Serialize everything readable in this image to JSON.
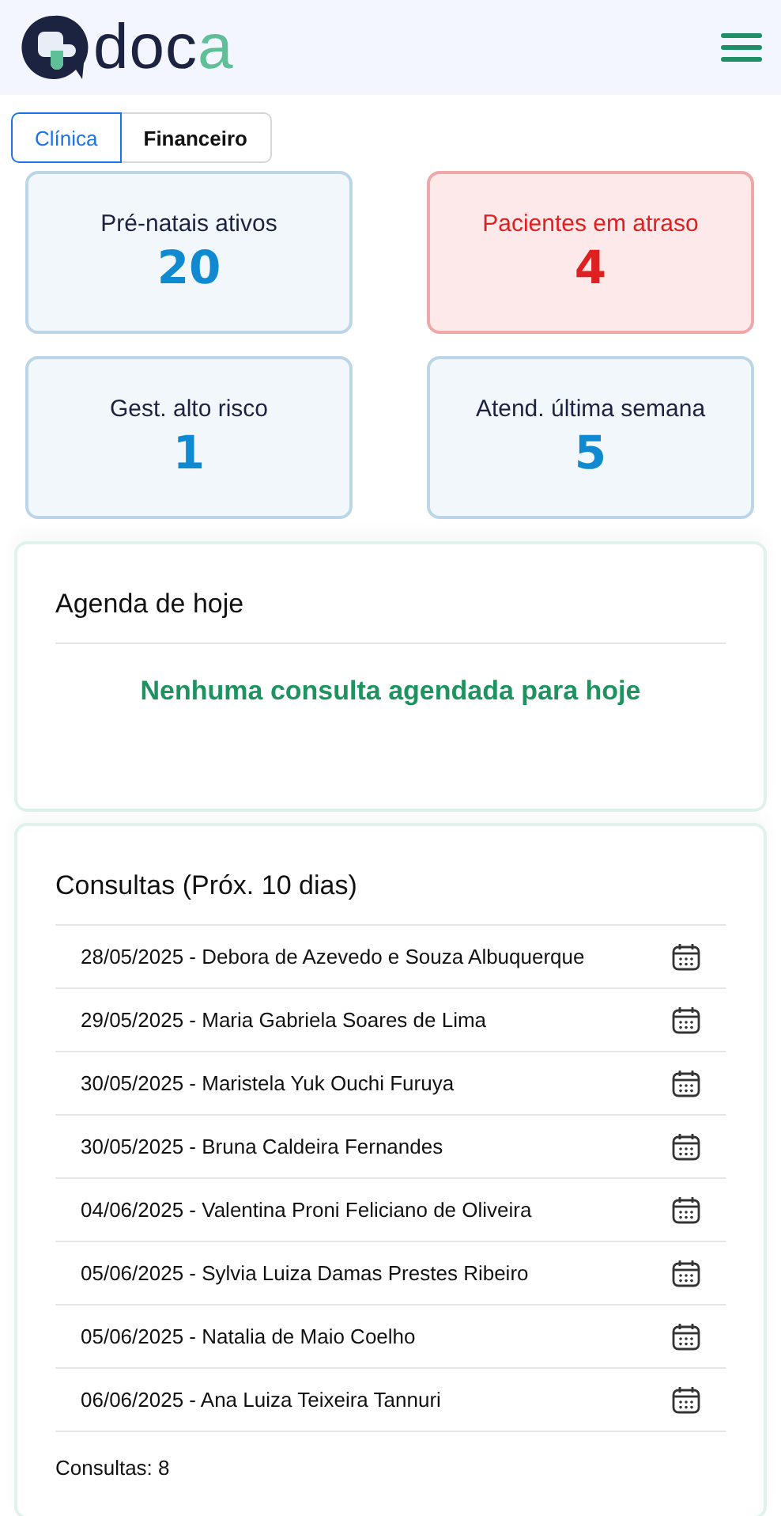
{
  "logo": {
    "text": "doc",
    "accent": "a"
  },
  "tabs": [
    {
      "label": "Clínica",
      "selected": true
    },
    {
      "label": "Financeiro",
      "selected": false
    }
  ],
  "stats": [
    {
      "label": "Pré-natais ativos",
      "value": "20",
      "alert": false
    },
    {
      "label": "Pacientes em atraso",
      "value": "4",
      "alert": true
    },
    {
      "label": "Gest. alto risco",
      "value": "1",
      "alert": false
    },
    {
      "label": "Atend. última semana",
      "value": "5",
      "alert": false
    }
  ],
  "agenda": {
    "title": "Agenda de hoje",
    "message": "Nenhuma consulta agendada para hoje"
  },
  "consultas": {
    "title": "Consultas (Próx. 10 dias)",
    "items": [
      "28/05/2025 - Debora de Azevedo e Souza Albuquerque",
      "29/05/2025 - Maria Gabriela Soares de Lima",
      "30/05/2025 - Maristela Yuk Ouchi Furuya",
      "30/05/2025 - Bruna Caldeira Fernandes",
      "04/06/2025 - Valentina Proni Feliciano de Oliveira",
      "05/06/2025 - Sylvia Luiza Damas Prestes Ribeiro",
      "05/06/2025 - Natalia de Maio Coelho",
      "06/06/2025 - Ana Luiza Teixeira Tannuri"
    ],
    "count": "Consultas: 8"
  }
}
